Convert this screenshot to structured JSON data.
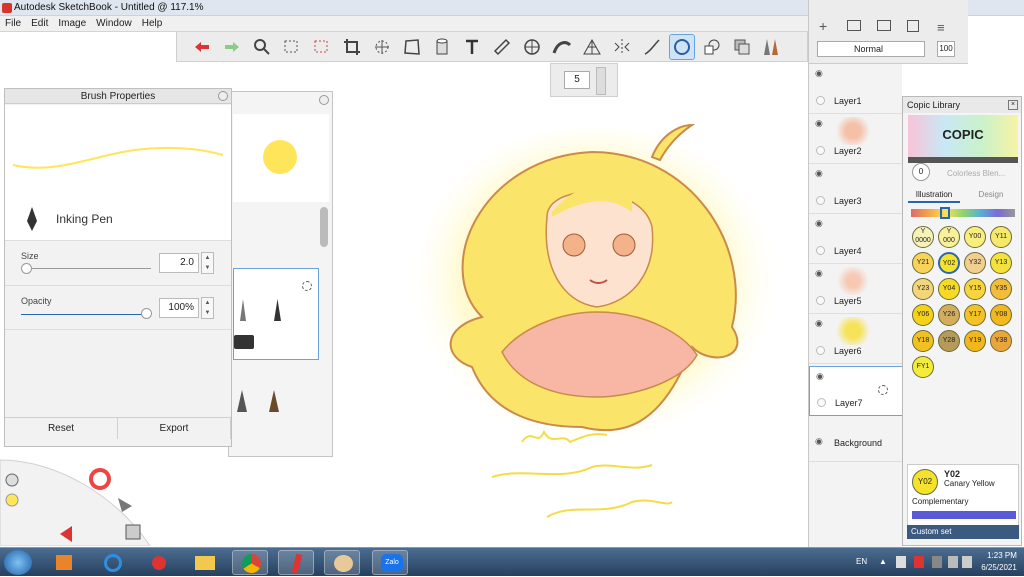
{
  "window": {
    "title": "Autodesk SketchBook - Untitled @ 117.1%"
  },
  "menu": [
    "File",
    "Edit",
    "Image",
    "Window",
    "Help"
  ],
  "toolbar": {
    "brush_size": "5"
  },
  "brush_properties": {
    "title": "Brush Properties",
    "brush_name": "Inking Pen",
    "size_label": "Size",
    "size_value": "2.0",
    "opacity_label": "Opacity",
    "opacity_value": "100%",
    "size_fraction": 0.0,
    "opacity_fraction": 1.0,
    "reset_label": "Reset",
    "export_label": "Export",
    "color": "#ffe85a"
  },
  "layer_panel": {
    "blend_mode": "Normal",
    "opacity": "100",
    "layers": [
      "Layer1",
      "Layer2",
      "Layer3",
      "Layer4",
      "Layer5",
      "Layer6",
      "Layer7"
    ],
    "background": "Background",
    "selected": "Layer7"
  },
  "copic": {
    "title": "Copic Library",
    "logo": "COPIC",
    "colorless_label": "Colorless Blen...",
    "swatch_num": "0",
    "tab_illustration": "Illustration",
    "tab_design": "Design",
    "swatches": [
      {
        "code": "Y\n0000",
        "color": "#f7f3b8"
      },
      {
        "code": "Y\n000",
        "color": "#f8f19a"
      },
      {
        "code": "Y00",
        "color": "#f9ee7c"
      },
      {
        "code": "Y11",
        "color": "#f6e96a"
      },
      {
        "code": "Y21",
        "color": "#f7d35a"
      },
      {
        "code": "Y02",
        "color": "#f5e32b"
      },
      {
        "code": "Y32",
        "color": "#f1cf8f"
      },
      {
        "code": "Y13",
        "color": "#f3e23c"
      },
      {
        "code": "Y23",
        "color": "#f4d67a"
      },
      {
        "code": "Y04",
        "color": "#f6da24"
      },
      {
        "code": "Y15",
        "color": "#f8d53e"
      },
      {
        "code": "Y35",
        "color": "#f3bd3c"
      },
      {
        "code": "Y06",
        "color": "#f5d21a"
      },
      {
        "code": "Y26",
        "color": "#d2ad5e"
      },
      {
        "code": "Y17",
        "color": "#f3c326"
      },
      {
        "code": "Y08",
        "color": "#f2b820"
      },
      {
        "code": "Y18",
        "color": "#f1c11f"
      },
      {
        "code": "Y28",
        "color": "#b59a5a"
      },
      {
        "code": "Y19",
        "color": "#f1b71c"
      },
      {
        "code": "Y38",
        "color": "#eaa63a"
      },
      {
        "code": "FY1",
        "color": "#f4ec3a"
      }
    ],
    "current_code": "Y02",
    "current_name": "Canary Yellow",
    "complementary_label": "Complementary",
    "custom_set_label": "Custom set"
  },
  "artwork": {
    "sign_line1": "Mam",
    "sign_line2": "tay danh dong",
    "sign_line3": "hvidep247"
  },
  "taskbar": {
    "lang": "EN",
    "time": "1:23 PM",
    "date": "6/25/2021",
    "zalo": "Zalo"
  }
}
